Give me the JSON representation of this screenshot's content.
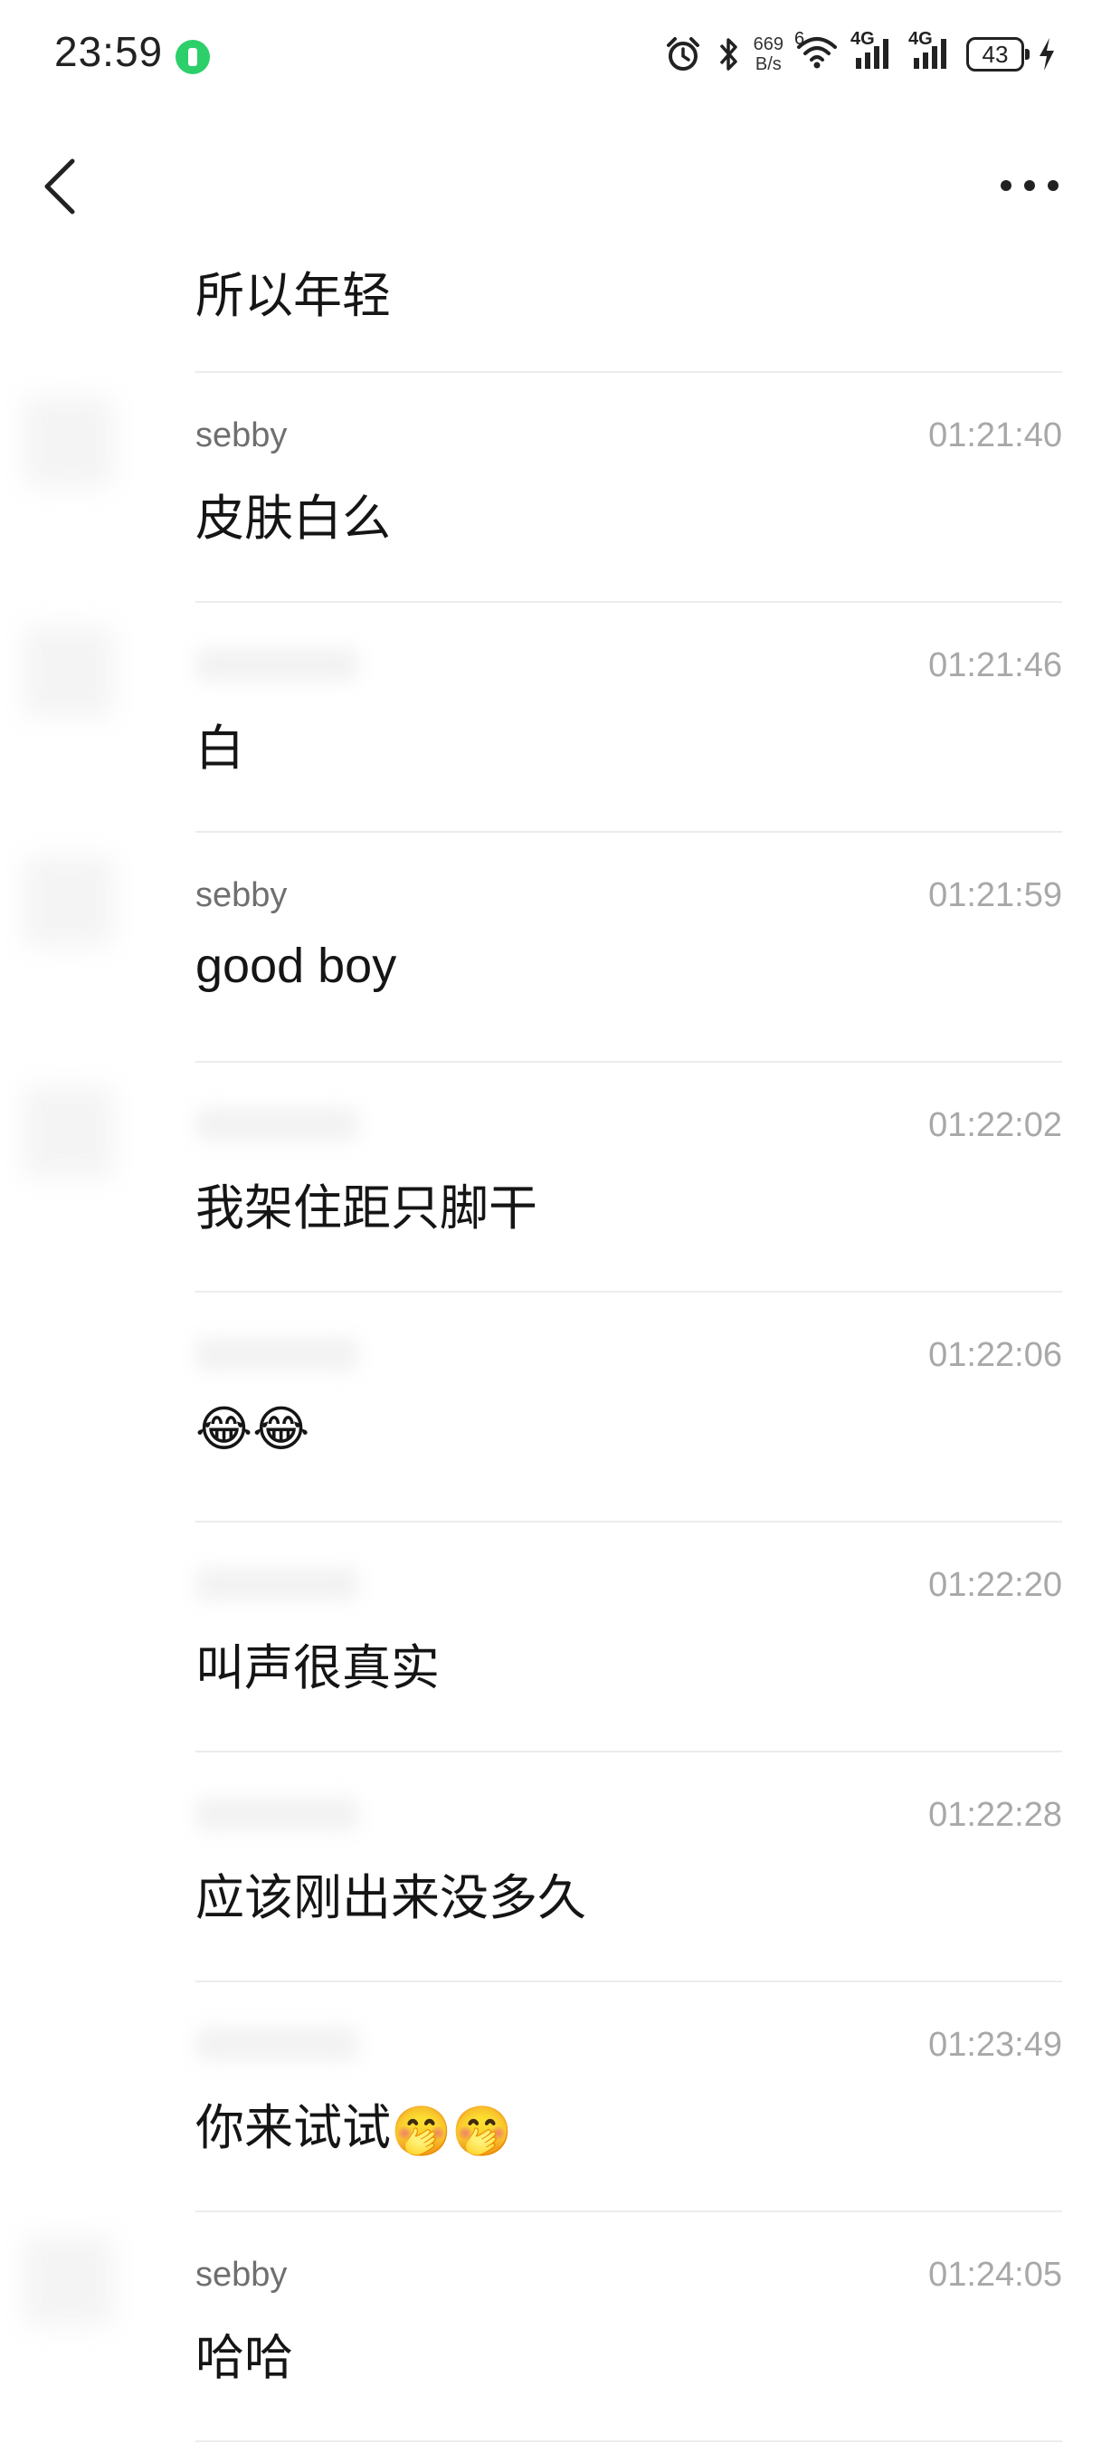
{
  "status_bar": {
    "time": "23:59",
    "net_speed_value": "669",
    "net_speed_unit": "B/s",
    "wifi_label": "6",
    "signal1_label": "4G",
    "signal2_label": "4G",
    "battery": "43"
  },
  "header": {
    "back_icon": "chevron-left-icon",
    "more_icon": "more-horizontal-icon"
  },
  "messages": [
    {
      "sender": "",
      "time": "",
      "text": "所以年轻",
      "emoji": ""
    },
    {
      "sender": "sebby",
      "time": "01:21:40",
      "text": "皮肤白么",
      "emoji": ""
    },
    {
      "sender": "",
      "time": "01:21:46",
      "text": "白",
      "emoji": ""
    },
    {
      "sender": "sebby",
      "time": "01:21:59",
      "text": "good boy",
      "emoji": ""
    },
    {
      "sender": "",
      "time": "01:22:02",
      "text": "我架住距只脚干",
      "emoji": ""
    },
    {
      "sender": "",
      "time": "01:22:06",
      "text": "",
      "emoji": "😂😂"
    },
    {
      "sender": "",
      "time": "01:22:20",
      "text": "叫声很真实",
      "emoji": ""
    },
    {
      "sender": "",
      "time": "01:22:28",
      "text": "应该刚出来没多久",
      "emoji": ""
    },
    {
      "sender": "",
      "time": "01:23:49",
      "text": "你来试试",
      "emoji": "🤭🤭"
    },
    {
      "sender": "sebby",
      "time": "01:24:05",
      "text": "哈哈",
      "emoji": ""
    }
  ],
  "colors": {
    "accent_green": "#2ccf6a",
    "time_gray": "#a8a8a8",
    "sender_gray": "#6f6f6f",
    "divider": "#ececec"
  }
}
